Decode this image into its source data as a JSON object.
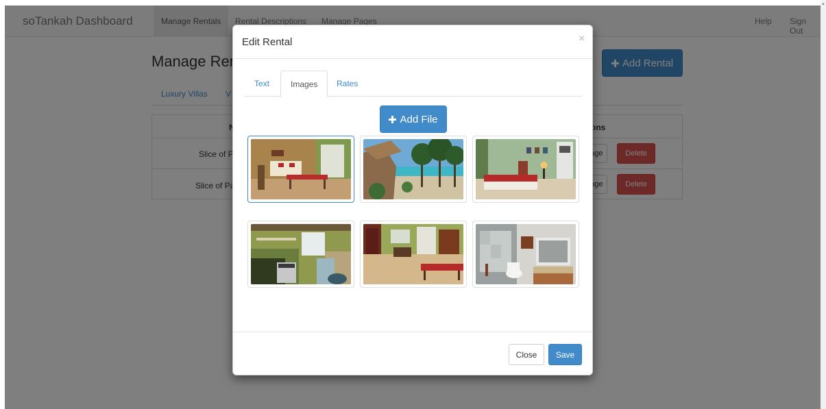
{
  "navbar": {
    "brand": "soTankah Dashboard",
    "items": [
      "Manage Rentals",
      "Rental Descriptions",
      "Manage Pages"
    ],
    "help": "Help",
    "sign_out": "Sign Out"
  },
  "page": {
    "heading": "Manage Renta",
    "add_rental_label": "Add Rental",
    "tabs": [
      "Luxury Villas",
      "V"
    ],
    "table": {
      "header_fragment": "N",
      "actions_fragment": "ons",
      "rows": [
        {
          "name_fragment": "Slice of P",
          "page_fragment": "'age",
          "delete": "Delete"
        },
        {
          "name_fragment": "Slice of Pa",
          "page_fragment": "'age",
          "delete": "Delete"
        }
      ]
    }
  },
  "modal": {
    "title": "Edit Rental",
    "close_symbol": "×",
    "tabs": [
      "Text",
      "Images",
      "Rates"
    ],
    "active_tab": "Images",
    "add_file_label": "Add File",
    "close_label": "Close",
    "save_label": "Save"
  },
  "colors": {
    "primary": "#428bca",
    "danger": "#d9534f",
    "navbar_bg": "#f8f8f8"
  }
}
